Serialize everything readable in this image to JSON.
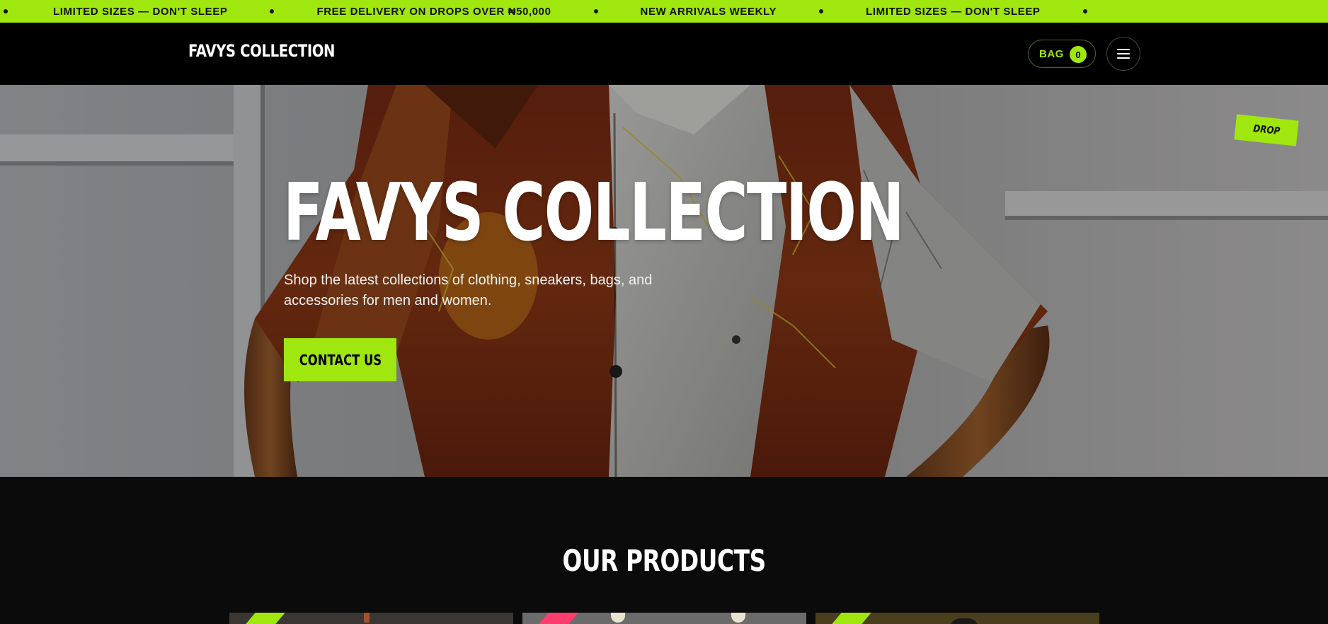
{
  "ticker": {
    "items": [
      "LIMITED SIZES — DON'T SLEEP",
      "FREE DELIVERY ON DROPS OVER ₦50,000",
      "NEW ARRIVALS WEEKLY",
      "LIMITED SIZES — DON'T SLEEP"
    ]
  },
  "header": {
    "brand": "FAVYS COLLECTION",
    "bag_label": "BAG",
    "bag_count": "0",
    "menu_icon": "hamburger-icon"
  },
  "hero": {
    "title": "FAVYS COLLECTION",
    "subtitle": "Shop the latest collections of clothing, sneakers, bags, and accessories for men and women.",
    "cta_label": "CONTACT US",
    "tag": "DROP"
  },
  "products": {
    "heading": "OUR PRODUCTS"
  },
  "colors": {
    "accent": "#a0e60f",
    "header_bg": "#000000",
    "page_bg": "#0b0b0b",
    "card_accent_pink": "#ff3d6e"
  }
}
